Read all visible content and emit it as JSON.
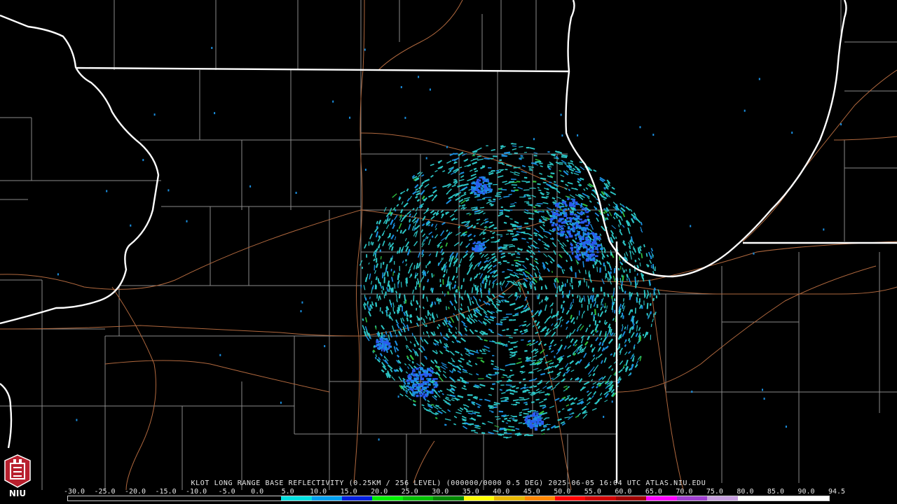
{
  "product_caption": "KLOT LONG RANGE BASE REFLECTIVITY (0.25KM / 256 LEVEL) (000000/0000 0.5 DEG) 2025-06-05 16:04 UTC  ATLAS.NIU.EDU",
  "logo_text": "NIU",
  "colorscale": {
    "labels": [
      "-30.0",
      "-25.0",
      "-20.0",
      "-15.0",
      "-10.0",
      "-5.0",
      "0.0",
      "5.0",
      "10.0",
      "15.0",
      "20.0",
      "25.0",
      "30.0",
      "35.0",
      "40.0",
      "45.0",
      "50.0",
      "55.0",
      "60.0",
      "65.0",
      "70.0",
      "75.0",
      "80.0",
      "85.0",
      "90.0",
      "94.5"
    ],
    "colors": [
      "#000000",
      "#000000",
      "#000000",
      "#000000",
      "#000000",
      "#000000",
      "#000000",
      "#00e0e0",
      "#00a0f0",
      "#0020e0",
      "#00f000",
      "#00c000",
      "#008800",
      "#ffff00",
      "#e8b800",
      "#ff8800",
      "#ff0000",
      "#d00000",
      "#a00000",
      "#ff00ff",
      "#a040d0",
      "#c8a0e0",
      "#ffffff",
      "#ffffff",
      "#ffffff"
    ]
  },
  "map_colors": {
    "state_border": "#ffffff",
    "county_border": "#8a8a8a",
    "highway": "#b0683e",
    "echo_light": "#2cc6c6",
    "echo_mid": "#1a8fe0",
    "echo_heavy": "#2a5cf0",
    "echo_green": "#30c040"
  }
}
